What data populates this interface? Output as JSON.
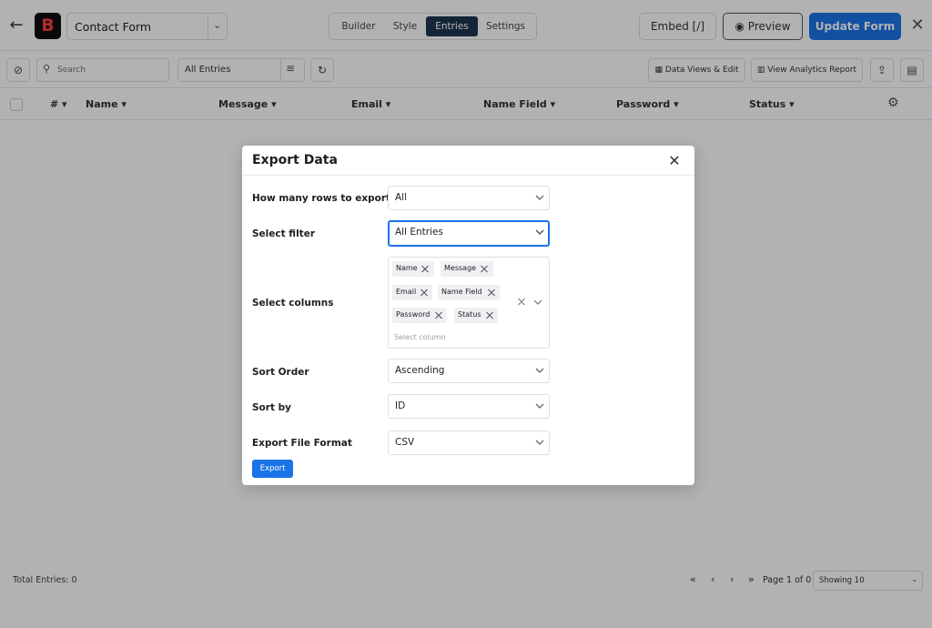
{
  "topbar": {
    "form_name": "Contact Form",
    "tabs": [
      {
        "label": "Builder",
        "active": false
      },
      {
        "label": "Style",
        "active": false
      },
      {
        "label": "Entries",
        "active": true
      },
      {
        "label": "Settings",
        "active": false
      }
    ],
    "embed_label": "Embed [/]",
    "preview_label": "Preview",
    "update_label": "Update Form",
    "accent_color": "#1a73e8"
  },
  "toolbar": {
    "search_placeholder": "Search",
    "entries_filter": "All Entries",
    "data_views_label": "Data Views & Edit",
    "analytics_label": "View Analytics Report"
  },
  "table": {
    "columns": [
      "#",
      "Name",
      "Message",
      "Email",
      "Name Field",
      "Password",
      "Status"
    ]
  },
  "footer": {
    "total_entries": "Total Entries: 0",
    "page_info": "Page 1 of 0",
    "showing": "Showing 10"
  },
  "modal": {
    "title": "Export Data",
    "rows_label": "How many rows to export",
    "rows_value": "All",
    "filter_label": "Select filter",
    "filter_value": "All Entries",
    "columns_label": "Select columns",
    "columns_selected": [
      "Name",
      "Message",
      "Email",
      "Name Field",
      "Password",
      "Status"
    ],
    "columns_placeholder": "Select column",
    "sort_order_label": "Sort Order",
    "sort_order_value": "Ascending",
    "sort_by_label": "Sort by",
    "sort_by_value": "ID",
    "format_label": "Export File Format",
    "format_value": "CSV",
    "export_button": "Export"
  }
}
